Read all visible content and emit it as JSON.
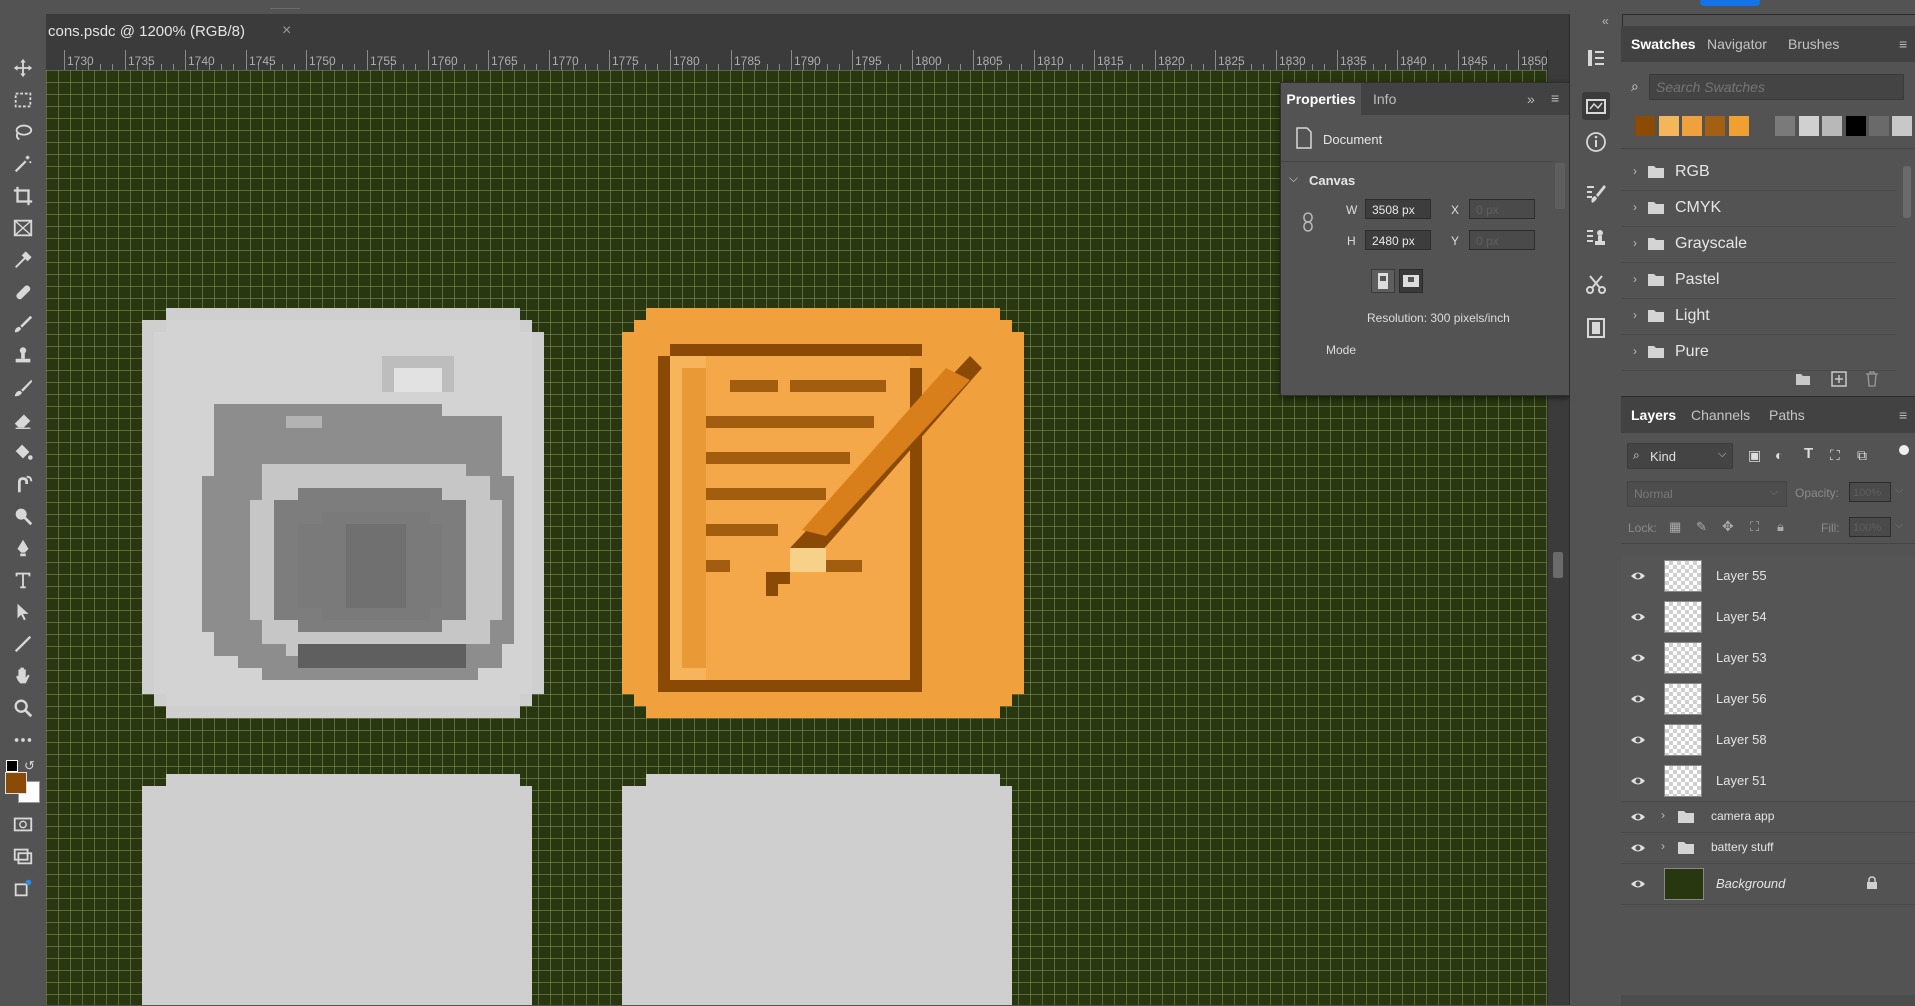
{
  "document": {
    "tab_title": "cons.psdc @ 1200% (RGB/8)",
    "close_glyph": "×",
    "background_color": "#283710"
  },
  "ruler": {
    "labels": [
      "1730",
      "1735",
      "1740",
      "1745",
      "1750",
      "1755",
      "1760",
      "1765",
      "1770",
      "1775",
      "1780",
      "1785",
      "1790",
      "1795",
      "1800",
      "1805",
      "1810",
      "1815",
      "1820",
      "1825",
      "1830",
      "1835",
      "1840",
      "1845",
      "1850"
    ]
  },
  "tools": [
    {
      "name": "move-tool-icon"
    },
    {
      "name": "marquee-tool-icon"
    },
    {
      "name": "lasso-tool-icon"
    },
    {
      "name": "magic-wand-tool-icon"
    },
    {
      "name": "crop-tool-icon"
    },
    {
      "name": "frame-tool-icon"
    },
    {
      "name": "eyedropper-tool-icon"
    },
    {
      "name": "healing-brush-tool-icon"
    },
    {
      "name": "brush-tool-icon"
    },
    {
      "name": "clone-stamp-tool-icon"
    },
    {
      "name": "history-brush-tool-icon"
    },
    {
      "name": "eraser-tool-icon"
    },
    {
      "name": "paint-bucket-tool-icon"
    },
    {
      "name": "smudge-tool-icon"
    },
    {
      "name": "dodge-tool-icon"
    },
    {
      "name": "pen-tool-icon"
    },
    {
      "name": "type-tool-icon"
    },
    {
      "name": "path-selection-tool-icon"
    },
    {
      "name": "line-tool-icon"
    },
    {
      "name": "hand-tool-icon"
    },
    {
      "name": "zoom-tool-icon"
    },
    {
      "name": "more-tools-icon"
    }
  ],
  "colors": {
    "foreground": "#8b4a06",
    "background": "#ffffff"
  },
  "properties": {
    "tabs": [
      "Properties",
      "Info"
    ],
    "document_label": "Document",
    "canvas_section": "Canvas",
    "width_label": "W",
    "width_value": "3508 px",
    "height_label": "H",
    "height_value": "2480 px",
    "x_label": "X",
    "x_placeholder": "0 px",
    "y_label": "Y",
    "y_placeholder": "0 px",
    "resolution": "Resolution: 300 pixels/inch",
    "mode_label": "Mode"
  },
  "swatches_panel": {
    "tabs": [
      "Swatches",
      "Navigator",
      "Brushes"
    ],
    "search_placeholder": "Search Swatches",
    "recent_colors": [
      "#8b4a06",
      "#f4b65a",
      "#eea13c",
      "#a35f12",
      "#f0a030",
      "#535353",
      "#7a7a7a",
      "#d0d0d0",
      "#b8b8b8",
      "#000000",
      "#6a6a6a",
      "#c8c8c8"
    ],
    "groups": [
      "RGB",
      "CMYK",
      "Grayscale",
      "Pastel",
      "Light",
      "Pure"
    ]
  },
  "layers_panel": {
    "tabs": [
      "Layers",
      "Channels",
      "Paths"
    ],
    "filter_label": "Kind",
    "blend_mode": "Normal",
    "opacity_label": "Opacity:",
    "opacity_value": "100%",
    "lock_label": "Lock:",
    "fill_label": "Fill:",
    "fill_value": "100%",
    "layers": [
      {
        "name": "Layer 55",
        "kind": "pixel"
      },
      {
        "name": "Layer 54",
        "kind": "pixel"
      },
      {
        "name": "Layer 53",
        "kind": "pixel"
      },
      {
        "name": "Layer 56",
        "kind": "pixel"
      },
      {
        "name": "Layer 58",
        "kind": "pixel"
      },
      {
        "name": "Layer 51",
        "kind": "pixel"
      },
      {
        "name": "camera app",
        "kind": "group"
      },
      {
        "name": "battery stuff",
        "kind": "group"
      },
      {
        "name": "Background",
        "kind": "background",
        "locked": true
      }
    ]
  }
}
